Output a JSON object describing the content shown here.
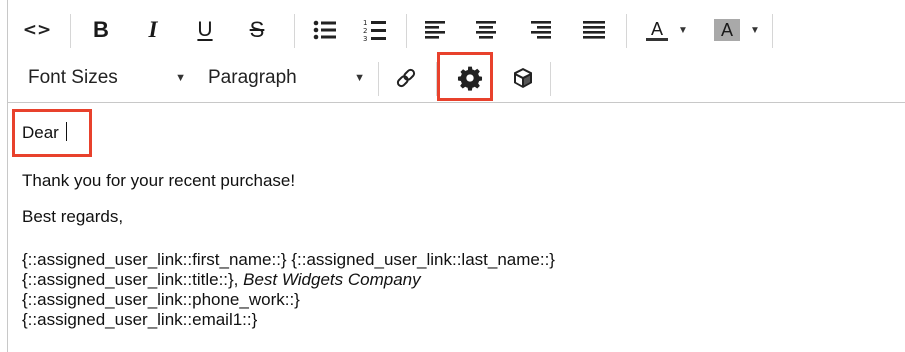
{
  "toolbar": {
    "source_code_glyph": "<>",
    "bold_glyph": "B",
    "italic_glyph": "I",
    "underline_glyph": "U",
    "strikethrough_glyph": "S",
    "bullet_list_glyph": "☰",
    "numbered_list_glyph": "☰",
    "align_left_glyph": "☰",
    "align_center_glyph": "☰",
    "align_right_glyph": "☰",
    "justify_glyph": "☰",
    "text_color_glyph": "A",
    "background_color_glyph": "A",
    "dropdown_caret": "▼",
    "font_sizes_label": "Font Sizes",
    "format_label": "Paragraph",
    "icons": [
      "code-icon",
      "bold-icon",
      "italic-icon",
      "underline-icon",
      "strikethrough-icon",
      "bullet-list-icon",
      "numbered-list-icon",
      "align-left-icon",
      "align-center-icon",
      "align-right-icon",
      "justify-icon",
      "text-color-icon",
      "background-color-icon",
      "link-icon",
      "gear-icon",
      "cube-icon"
    ],
    "highlight_color": "#e8412c"
  },
  "content": {
    "greeting": "Dear ",
    "thanks": "Thank you for your recent purchase!",
    "closing": "Best regards,",
    "signature": {
      "line1": "{::assigned_user_link::first_name::} {::assigned_user_link::last_name::}",
      "line2_prefix": "{::assigned_user_link::title::}, ",
      "line2_company": "Best Widgets Company",
      "line3": "{::assigned_user_link::phone_work::}",
      "line4": "{::assigned_user_link::email1::}"
    }
  }
}
